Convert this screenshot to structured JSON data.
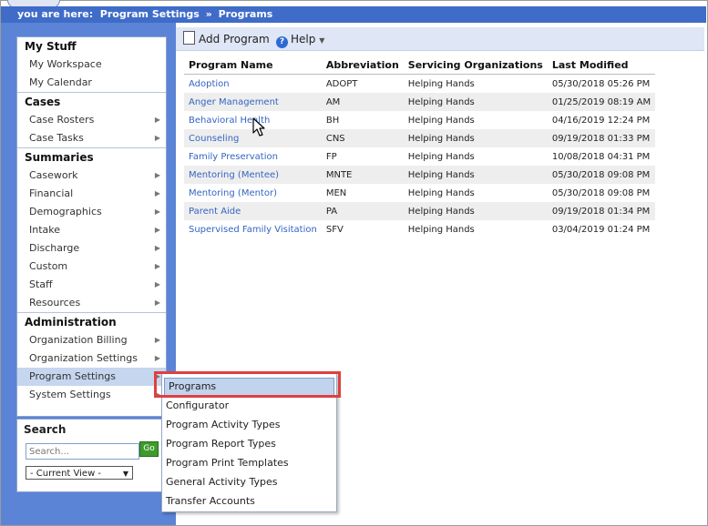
{
  "breadcrumb": {
    "prefix": "you are here:",
    "parent": "Program Settings",
    "separator": "»",
    "current": "Programs"
  },
  "sidebar": {
    "sections": [
      {
        "title": "My Stuff",
        "items": [
          {
            "label": "My Workspace",
            "has_arrow": false
          },
          {
            "label": "My Calendar",
            "has_arrow": false
          }
        ]
      },
      {
        "title": "Cases",
        "items": [
          {
            "label": "Case Rosters",
            "has_arrow": true
          },
          {
            "label": "Case Tasks",
            "has_arrow": true
          }
        ]
      },
      {
        "title": "Summaries",
        "items": [
          {
            "label": "Casework",
            "has_arrow": true
          },
          {
            "label": "Financial",
            "has_arrow": true
          },
          {
            "label": "Demographics",
            "has_arrow": true
          },
          {
            "label": "Intake",
            "has_arrow": true
          },
          {
            "label": "Discharge",
            "has_arrow": true
          },
          {
            "label": "Custom",
            "has_arrow": true
          },
          {
            "label": "Staff",
            "has_arrow": true
          },
          {
            "label": "Resources",
            "has_arrow": true
          }
        ]
      },
      {
        "title": "Administration",
        "items": [
          {
            "label": "Organization Billing",
            "has_arrow": true
          },
          {
            "label": "Organization Settings",
            "has_arrow": true
          },
          {
            "label": "Program Settings",
            "has_arrow": true,
            "active": true
          },
          {
            "label": "System Settings",
            "has_arrow": true
          }
        ]
      }
    ]
  },
  "search": {
    "title": "Search",
    "placeholder": "Search...",
    "go_label": "Go",
    "view_label": "- Current View -"
  },
  "toolbar": {
    "add_label": "Add Program",
    "help_label": "Help"
  },
  "table": {
    "headers": [
      "Program Name",
      "Abbreviation",
      "Servicing Organizations",
      "Last Modified"
    ],
    "rows": [
      [
        "Adoption",
        "ADOPT",
        "Helping Hands",
        "05/30/2018 05:26 PM"
      ],
      [
        "Anger Management",
        "AM",
        "Helping Hands",
        "01/25/2019 08:19 AM"
      ],
      [
        "Behavioral Health",
        "BH",
        "Helping Hands",
        "04/16/2019 12:24 PM"
      ],
      [
        "Counseling",
        "CNS",
        "Helping Hands",
        "09/19/2018 01:33 PM"
      ],
      [
        "Family Preservation",
        "FP",
        "Helping Hands",
        "10/08/2018 04:31 PM"
      ],
      [
        "Mentoring (Mentee)",
        "MNTE",
        "Helping Hands",
        "05/30/2018 09:08 PM"
      ],
      [
        "Mentoring (Mentor)",
        "MEN",
        "Helping Hands",
        "05/30/2018 09:08 PM"
      ],
      [
        "Parent Aide",
        "PA",
        "Helping Hands",
        "09/19/2018 01:34 PM"
      ],
      [
        "Supervised Family Visitation",
        "SFV",
        "Helping Hands",
        "03/04/2019 01:24 PM"
      ]
    ]
  },
  "flyout": {
    "items": [
      {
        "label": "Programs",
        "selected": true
      },
      {
        "label": "Configurator"
      },
      {
        "label": "Program Activity Types"
      },
      {
        "label": "Program Report Types"
      },
      {
        "label": "Program Print Templates"
      },
      {
        "label": "General Activity Types"
      },
      {
        "label": "Transfer Accounts"
      }
    ]
  },
  "colors": {
    "topbar": "#3f6cc8",
    "sidebar_bg": "#5b84d6",
    "link": "#3465c4",
    "highlight": "#e03f3f"
  }
}
